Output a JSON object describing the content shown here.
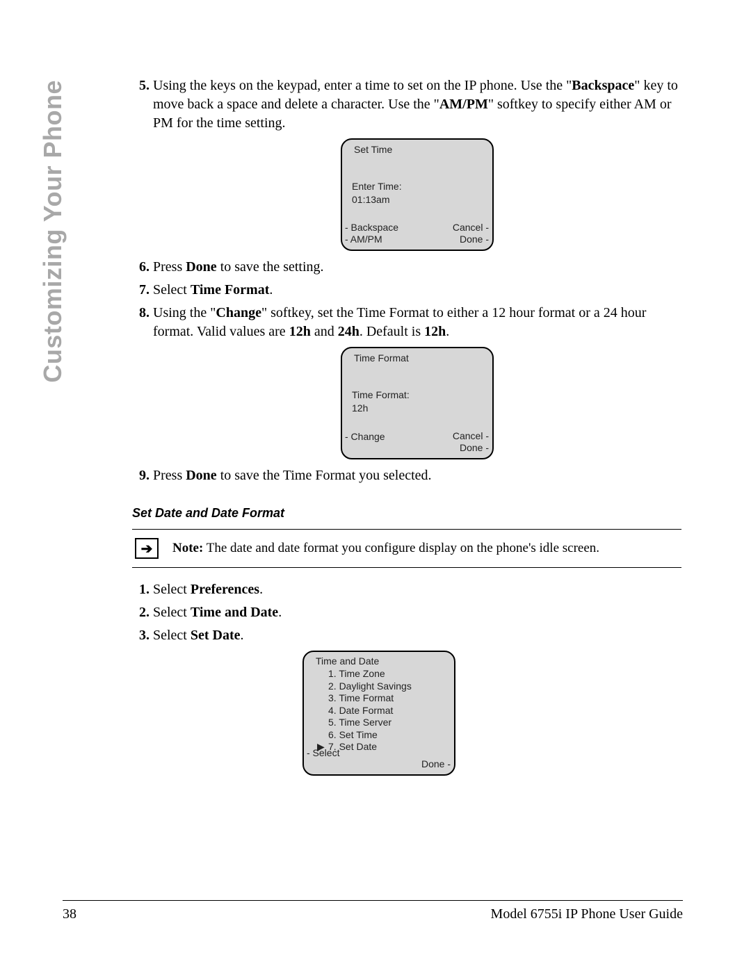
{
  "sideTab": "Customizing Your Phone",
  "steps1": {
    "s5": {
      "pre": "Using the keys on the keypad, enter a time to set on the IP phone. Use the \"",
      "b1": "Backspace",
      "mid1": "\" key to move back a space and delete a character. Use the \"",
      "b2": "AM/PM",
      "post": "\" softkey to specify either AM or PM for the time setting."
    },
    "s6": {
      "pre": "Press ",
      "b": "Done",
      "post": " to save the setting."
    },
    "s7": {
      "pre": "Select ",
      "b": "Time Format",
      "post": "."
    },
    "s8": {
      "pre": "Using the \"",
      "b1": "Change",
      "mid1": "\" softkey, set the Time Format to either a 12 hour format or a 24 hour format. Valid values are ",
      "b2": "12h",
      "mid2": " and ",
      "b3": "24h",
      "mid3": ". Default is ",
      "b4": "12h",
      "post": "."
    },
    "s9": {
      "pre": "Press ",
      "b": "Done",
      "post": " to save the Time Format you selected."
    }
  },
  "screen1": {
    "title": "Set Time",
    "label": "Enter Time:",
    "value": "01:13am",
    "sk_bl1": "- Backspace",
    "sk_bl2": "- AM/PM",
    "sk_br1": "Cancel -",
    "sk_br2": "Done -"
  },
  "screen2": {
    "title": "Time Format",
    "label": "Time Format:",
    "value": "12h",
    "sk_bl1": "- Change",
    "sk_br1": "Cancel -",
    "sk_br2": "Done -"
  },
  "subhead": "Set Date and Date Format",
  "note": {
    "label": "Note:",
    "text": " The date and date format you configure display on the phone's idle screen."
  },
  "steps2": {
    "s1": {
      "pre": "Select ",
      "b": "Preferences",
      "post": "."
    },
    "s2": {
      "pre": "Select ",
      "b": "Time and Date",
      "post": "."
    },
    "s3": {
      "pre": "Select ",
      "b": "Set Date",
      "post": "."
    }
  },
  "screen3": {
    "title": "Time and Date",
    "items": [
      "1. Time Zone",
      "2. Daylight Savings",
      "3. Time Format",
      "4. Date Format",
      "5. Time Server",
      "6. Set Time",
      "7. Set Date"
    ],
    "marker": "▶",
    "selected_index": 6,
    "sk_bl1": "- Select",
    "sk_br1": "Done -"
  },
  "footer": {
    "page": "38",
    "title": "Model 6755i IP Phone User Guide"
  }
}
